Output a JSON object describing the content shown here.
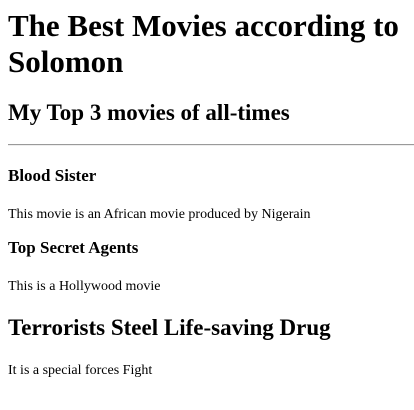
{
  "page": {
    "title": "The Best Movies according to Solomon",
    "subtitle": "My Top 3 movies of all-times"
  },
  "movies": [
    {
      "title": "Blood Sister",
      "description": "This movie is an African movie produced by Nigerain"
    },
    {
      "title": "Top Secret Agents",
      "description": "This is a Hollywood movie"
    },
    {
      "title": "Terrorists Steel Life-saving Drug",
      "description": "It is a special forces Fight"
    }
  ]
}
